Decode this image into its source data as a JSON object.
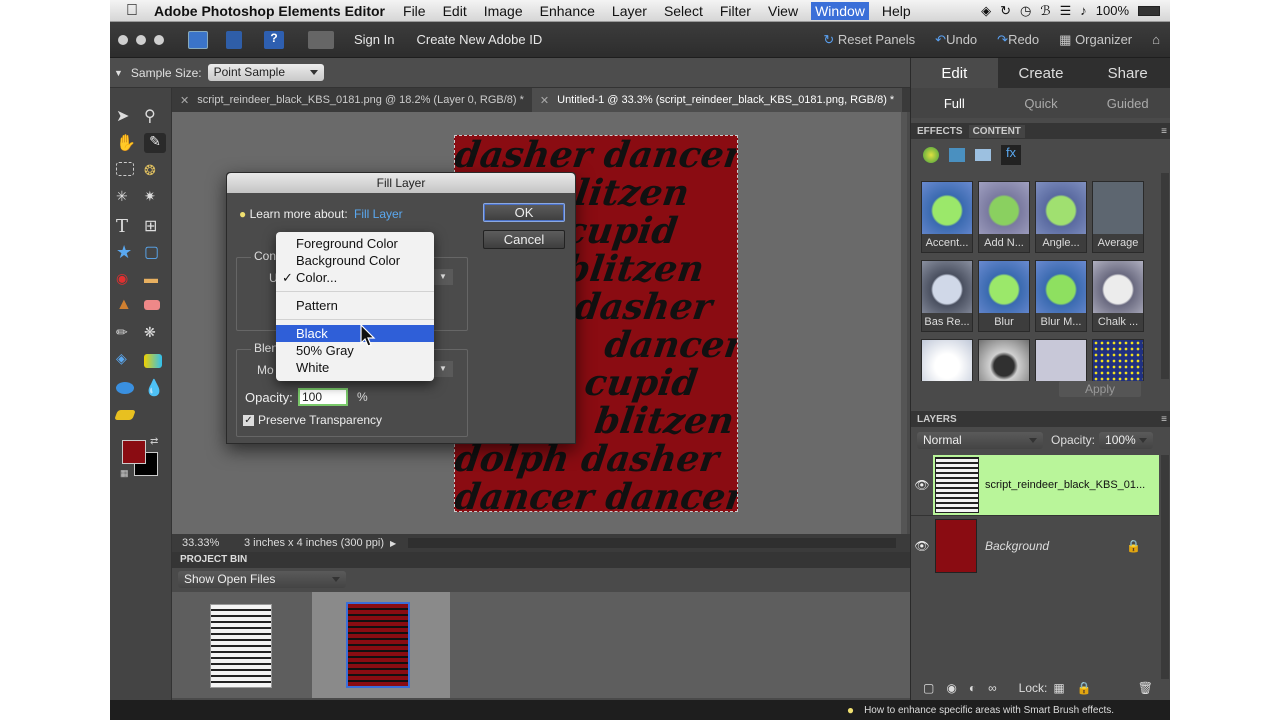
{
  "menubar": {
    "app_name": "Adobe Photoshop Elements Editor",
    "items": [
      "File",
      "Edit",
      "Image",
      "Enhance",
      "Layer",
      "Select",
      "Filter",
      "View",
      "Window",
      "Help"
    ],
    "battery": "100%"
  },
  "appbar": {
    "sign_in": "Sign In",
    "create_id": "Create New Adobe ID",
    "reset_panels": "Reset Panels",
    "undo": "Undo",
    "redo": "Redo",
    "organizer": "Organizer"
  },
  "options": {
    "sample_size_label": "Sample Size:",
    "sample_size_value": "Point Sample"
  },
  "tabs": [
    {
      "label": "script_reindeer_black_KBS_0181.png @ 18.2% (Layer 0, RGB/8) *"
    },
    {
      "label": "Untitled-1 @ 33.3% (script_reindeer_black_KBS_0181.png, RGB/8) *"
    }
  ],
  "doc": {
    "lines": [
      "dasher dancer",
      "dblitzen",
      "cupid",
      "blitzen",
      "dasher",
      "dancer",
      "cupid",
      "blitzen",
      "dolph dasher",
      "dancer dancer"
    ]
  },
  "status": {
    "zoom": "33.33%",
    "info": "3 inches x 4 inches (300 ppi)"
  },
  "bin": {
    "header": "PROJECT BIN",
    "show": "Show Open Files"
  },
  "right": {
    "modes": [
      "Edit",
      "Create",
      "Share"
    ],
    "subs": [
      "Full",
      "Quick",
      "Guided"
    ],
    "effects_tab": "EFFECTS",
    "content_tab": "CONTENT",
    "effects": [
      "Accent...",
      "Add N...",
      "Angle...",
      "Average",
      "Bas Re...",
      "Blur",
      "Blur M...",
      "Chalk ..."
    ],
    "apply": "Apply",
    "layers_header": "LAYERS",
    "blend": "Normal",
    "opacity_label": "Opacity:",
    "opacity_value": "100%",
    "layers": [
      {
        "name": "script_reindeer_black_KBS_01..."
      },
      {
        "name": "Background"
      }
    ],
    "lock_label": "Lock:"
  },
  "dialog": {
    "title": "Fill Layer",
    "learn_label": "Learn more about:",
    "learn_link": "Fill Layer",
    "ok": "OK",
    "cancel": "Cancel",
    "contents_label": "Con",
    "use_label": "U",
    "blending_label": "Blen",
    "mode_label": "Mo",
    "opacity_label": "Opacity:",
    "opacity_value": "100",
    "percent": "%",
    "preserve": "Preserve Transparency"
  },
  "dropdown": {
    "items": [
      "Foreground Color",
      "Background Color",
      "Color...",
      "Pattern",
      "Black",
      "50% Gray",
      "White"
    ],
    "checked": "✓",
    "highlighted": "Black"
  },
  "hint": "How to enhance specific areas with Smart Brush effects.",
  "colors": {
    "foreground": "#8a0c12",
    "background": "#000000",
    "selected_layer": "#b9f59a"
  }
}
